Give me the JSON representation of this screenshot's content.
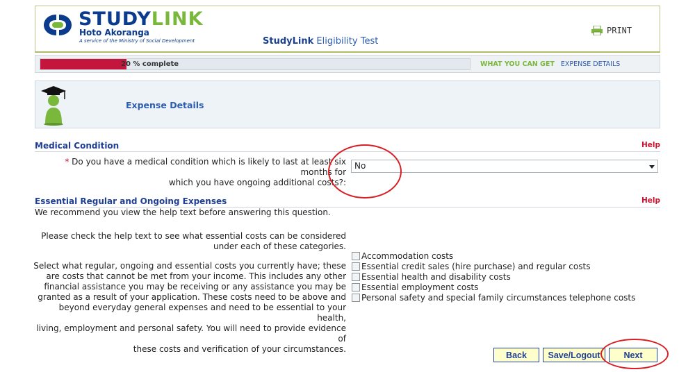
{
  "header": {
    "brand_study": "STUDY",
    "brand_link": "LINK",
    "brand_sub": "Hoto Akoranga",
    "brand_tagline": "A service of the Ministry of Social Development",
    "app_title_bold": "StudyLink",
    "app_title_rest": " Eligibility Test",
    "print_label": "PRINT"
  },
  "progress": {
    "percent": 20,
    "label": "20 % complete",
    "current_step": "WHAT YOU CAN GET",
    "next_step": "EXPENSE DETAILS"
  },
  "banner": {
    "title": "Expense Details"
  },
  "medical": {
    "title": "Medical Condition",
    "help": "Help",
    "required_marker": "*",
    "question_line1": " Do you have a medical condition which is likely to last at least six months for",
    "question_line2": "which you have ongoing additional costs?:",
    "selected_value": "No"
  },
  "expenses": {
    "title": "Essential Regular and Ongoing Expenses",
    "help": "Help",
    "recommend": "We recommend you view the help text before answering this question.",
    "help_text_line1": "Please check the help text to see what essential costs can be considered",
    "help_text_line2": "under each of these categories.",
    "select_text": [
      "Select what regular, ongoing and essential costs you currently have; these",
      "are costs that cannot be met from your income. This includes any other",
      "financial assistance you may be receiving or any assistance you may be",
      "granted as a result of your application. These costs need to be above and",
      "beyond everyday general expenses and need to be essential to your health,",
      "living, employment and personal safety. You will need to provide evidence of",
      "these costs and verification of your circumstances."
    ],
    "options": [
      "Accommodation costs",
      "Essential credit sales (hire purchase) and regular costs",
      "Essential health and disability costs",
      "Essential employment costs",
      "Personal safety and special family circumstances telephone costs"
    ]
  },
  "buttons": {
    "back": "Back",
    "save": "Save/Logout",
    "next": "Next"
  },
  "colors": {
    "brand_blue": "#0b3b8c",
    "brand_green": "#7ab83b",
    "progress_red": "#c4163c",
    "annotation_red": "#d81f26"
  }
}
